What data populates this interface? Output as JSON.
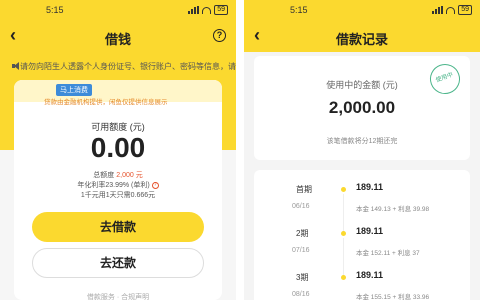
{
  "left": {
    "status_time": "5:15",
    "battery": "59",
    "title": "借钱",
    "help_label": "?",
    "notice": "请勿向陌生人透露个人身份证号、银行账户、密码等信息，请",
    "badge": "马上消费",
    "tip": "贷款由金融机构提供，闲鱼仅提供信息展示",
    "available_label": "可用额度 (元)",
    "available_amount": "0.00",
    "total_label": "总额度",
    "total_amount": "2,000 元",
    "rate_text": "年化利率23.99% (单利)",
    "daily_text": "1千元用1天只需0.666元",
    "borrow_button": "去借款",
    "repay_button": "去还款",
    "footer": "借款服务 · 合规声明"
  },
  "right": {
    "status_time": "5:15",
    "battery": "59",
    "title": "借款记录",
    "in_use_label": "使用中的金额 (元)",
    "in_use_amount": "2,000.00",
    "stamp": "使用中",
    "installment_note": "该笔借款将分12期还完",
    "installments": [
      {
        "period": "首期",
        "date": "06/16",
        "amount": "189.11",
        "detail": "本金 149.13 + 利息 39.98"
      },
      {
        "period": "2期",
        "date": "07/16",
        "amount": "189.11",
        "detail": "本金 152.11 + 利息 37"
      },
      {
        "period": "3期",
        "date": "08/16",
        "amount": "189.11",
        "detail": "本金 155.15 + 利息 33.96"
      }
    ]
  },
  "colors": {
    "accent": "#fbd92f",
    "highlight": "#e6542e",
    "stamp": "#4bb58a"
  }
}
